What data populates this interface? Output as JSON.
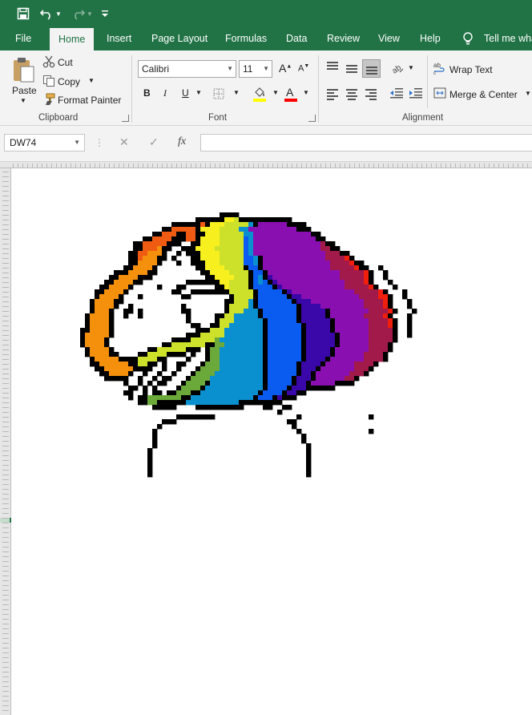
{
  "ribbon_tabs": [
    "File",
    "Home",
    "Insert",
    "Page Layout",
    "Formulas",
    "Data",
    "Review",
    "View",
    "Help"
  ],
  "tell_me": "Tell me wha",
  "clipboard": {
    "paste": "Paste",
    "cut": "Cut",
    "copy": "Copy",
    "format_painter": "Format Painter",
    "group_label": "Clipboard"
  },
  "font": {
    "name": "Calibri",
    "size": "11",
    "bold": "B",
    "italic": "I",
    "underline": "U",
    "font_color_glyph": "A",
    "font_color": "#ff0000",
    "fill_color": "#ffff00",
    "group_label": "Font"
  },
  "alignment": {
    "wrap_text": "Wrap Text",
    "merge_center": "Merge & Center",
    "group_label": "Alignment"
  },
  "formula_bar": {
    "name_box": "DW74",
    "fx": "fx",
    "value": ""
  },
  "colors": {
    "brand": "#217346",
    "art": {
      "K": "#000000",
      "o": "#ef5b12",
      "O": "#f4900c",
      "Y": "#f7f01e",
      "L": "#cde12a",
      "G": "#6aa93a",
      "B": "#0a8fcf",
      "b": "#0a5cf0",
      "I": "#3a07a8",
      "V": "#8a0fb0",
      "M": "#a11a4a",
      "R": "#f01e0c"
    }
  },
  "pixel_art": {
    "description_free": true,
    "cell_size": 6,
    "rows": [
      "...........................................................................................",
      "...........................................................................................",
      "...........................................................................................",
      "...........................................................................................",
      "...........................................................................................",
      "...........................................................................................",
      "...........................................................................................",
      "...........................................................................................",
      "...........................................................................................",
      "...........................................KKKK............................................",
      "......................................KKKKKKYYLKKKKKKKKKKK.................................",
      ".................................KKKKKKoKYYYLLLLLBKVVVVVVKKKK..............................",
      "...............................KKoooooKYYYYLLLLBBVVVVVVVVVVKKK............................",
      ".............................KKoooKKooKKYYYLLLLLBBVVVVVVVVVVVVKK...........................",
      "...........................KKooooKKKooKYYYYLLLLLbBVVVVVVVVVVVVVKK..........................",
      ".........................KKoooooKKK..KKYYYYLLLLLbBVVVVVVVVVVVVVVMKK........................",
      ".........................KKoooOKK..KKKYYYYLLLLLLbBVVVVVVVVVVVVVVMMKK.......................",
      "........................KKooOOOK..K.KKKYYYYLLLLLbBVVVVVVVVVVVVVVVMMMKK.....................",
      "........................KKoOOOKK.K...KKYYYYLLLLLbbBKVVVVVVVVVVVVVMMMMRK.....................",
      "........................KKOOOOK...K..KKKYYYLLLLLbbBKVVVVVVVVVVVVVVMMMMRKK...................",
      ".......................KKOOOOK........KKYYYYLLLLKbbKVVVVVVVVVVVVVVMMMMMRKK..K...............",
      ".....................KKKOOOOKK.........KKYYYYLLLLKbbKVVVVVVVVVVVVVVVMMMMMRK..K...............",
      "....................KKOOOOKKK...........KKYYYYLLLKbBKIVVVVVVVVVVVVVVMMMMMRK..K..............",
      "...................KKOOOOKK.........KKKKKKKYYLLLLKbBbKIVVVVVVVVVVVVVVMMMMRK...K.............",
      "..................KKOOOOK.....K...KK......KKYLLLLKbbbbKIVVVVVVVVVVVVVMMMMMRK...K............",
      ".................KKOOOOK.........KK..KKKKKKKKLLLLLKbbbbbKIVVVVVVVVVVVVVMMMMMRK...K...........",
      ".................KOOOOK...K........KK........KLLLLKbbbbbbKIIVVVVVVVVVVVVMMMMRRK..K...........",
      "................KOOOOKK.....................KKLLLBKbbbbbbbKIIIVVVVVVVVVVVMMMMRK...K...........",
      "................KOOOOK..K..........K........KLLLLBKbbbbbbbbKIIIIVVVVVVVVVMMMMRK...K...........",
      "................KOOOK..KK.K........KK.......KLLLBBBKbbbbbbbKIIIIIKVVVVVVVVMMMMRK...K...........",
      "...............KOOOOK..K..K.........K.....KKLLBBBBBKbbbbbbbKIIIIIKVVVVVVVMMMMRK...K...........",
      "...............KOOOOK...............K.....KLLLBBBBBBKbbbbbbKIIIIIIKVVVVVVVMMMMRK..K...........",
      "...............KOOOOK................KK..KKLLBBBBBBBKbbbbbbbKIIIIIKVVVVVVVMMMMRK..K...........",
      "..............KKOOOOK.................KKKLLLBBBBBBBBKbbbbbbbKIIIIIKVVVVVVVMMMMMK..K...........",
      "..............KOOOOOK...............KKKLLLLLBBBBBBBBKbbbbbbbKIIIIIIKVVVVVVMMMMMK..K...........",
      "..............KOOOOK.............KKKKLLLLLGBBBBBBBBBKbbbbbbbKIIIIIIKVVVVVVMMMMMK...........",
      "..............KOOOOK...........KKLLLLLLLKKGGBBBBBBBBKbbbbbbbKIIIIIIKVVVVVVMMMMK............",
      "...............KOOOOK.......KKLLLLLLKKK.KGGBBBBBBBBBKbbbbbbbKIIIIIKVVVVVVVMMMMK............",
      "...............KOOOOKK....KKLLLLKKKK.K..KGGBBBBBBBBBKbbbbbbbKIIIIIKVVVVVVMMMMK.............",
      "................KOOOOOKKKKLLLLKK....K...KGGBBBBBBBBBKbbbbbbbKIIIIKVVVVVVVMMMMK.............",
      "................KKOOOOOOKKLLKK.K..KK...KGGGBBBBBBBBBKbbbbbbKIIIIKVVVVVVMMMMK..............",
      ".................KKOOOOOOKKKK..K..K...KGGGGBBBBBBBBBKbbbbbbKIIIKVVVVVVVMMMK...............",
      "..................KKOOOOK..K..K..K...KGGGGBBBBBBBBBBKbbbbbbKIIKVVVVVVVMMMK................",
      "...................KKKKK..K..K.KK...KGGGGBBBBBBBBBBBKbbbbbKIIIKVVVVVVMMK.................",
      ".......................K..K.K.KK...KGGGGKBBBBBBBBBBBKbbbbbKIIKVVVVVKKKK.................",
      "........................KK.K.K....KGGGGKBBBBBBBBBBBBKbbbbKIIIKKKKKK.....................",
      ".......................KK..K.KK.KKGGGKKBBBBBBBBBBBBKbbbbKIIKK...........................",
      "........................K.KKGGGGGGGKKBBBBBBBBBBBBBKbbbKIKKK............................",
      "..........................KKGGKKKKKKBBBBBBBBBBBKKKKKKKKK...............................",
      ".............................KKKKK....KKKKKKKKKK....KK..KK..............................",
      ".......................................................K...............................",
      "..................................KKKKKKKK.................K..............K..............",
      "...............................KKK.......................KK............................",
      "..............................K...........................K.............................",
      ".............................K.............................K..............K............",
      ".............................K..............................K..........................",
      ".............................K..............................K..........................",
      ".............................K...............................K.........................",
      "............................K................................K.........................",
      "............................K................................K.........................",
      "............................K................................K.........................",
      "............................K................................K.........................",
      "............................K................................K.........................",
      "............................K................................K........................."
    ]
  }
}
